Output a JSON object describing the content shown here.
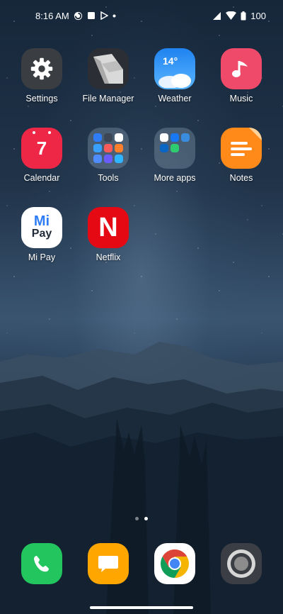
{
  "status_bar": {
    "time": "8:16 AM",
    "battery": "100",
    "left_icons": [
      "sync-icon",
      "stop-icon",
      "play-store-icon",
      "more-dot-icon"
    ],
    "right_icons": [
      "signal-icon",
      "wifi-icon",
      "battery-icon"
    ]
  },
  "apps": [
    {
      "label": "Settings",
      "icon": "gear-icon"
    },
    {
      "label": "File Manager",
      "icon": "file-manager-icon"
    },
    {
      "label": "Weather",
      "icon": "weather-icon",
      "badge": "14°"
    },
    {
      "label": "Music",
      "icon": "music-note-icon"
    },
    {
      "label": "Calendar",
      "icon": "calendar-icon",
      "badge": "7"
    },
    {
      "label": "Tools",
      "icon": "folder-icon"
    },
    {
      "label": "More apps",
      "icon": "folder-icon"
    },
    {
      "label": "Notes",
      "icon": "notes-icon"
    },
    {
      "label": "Mi Pay",
      "icon": "mi-pay-icon",
      "brand_top": "Mi",
      "brand_bottom": "Pay"
    },
    {
      "label": "Netflix",
      "icon": "netflix-icon",
      "brand": "N"
    }
  ],
  "page_indicator": {
    "pages": 2,
    "current": 2
  },
  "dock": [
    {
      "name": "phone",
      "icon": "phone-icon"
    },
    {
      "name": "messages",
      "icon": "message-icon"
    },
    {
      "name": "chrome",
      "icon": "chrome-icon"
    },
    {
      "name": "camera",
      "icon": "camera-icon"
    }
  ],
  "colors": {
    "settings_bg": "#3a3d42",
    "weather_bg": "#2d8ff0",
    "music_bg": "#f04a6a",
    "calendar_bg": "#ee2747",
    "notes_bg": "#ff8a1a",
    "netflix_bg": "#e50914",
    "phone_bg": "#22c55e",
    "messages_bg": "#ffa600"
  }
}
